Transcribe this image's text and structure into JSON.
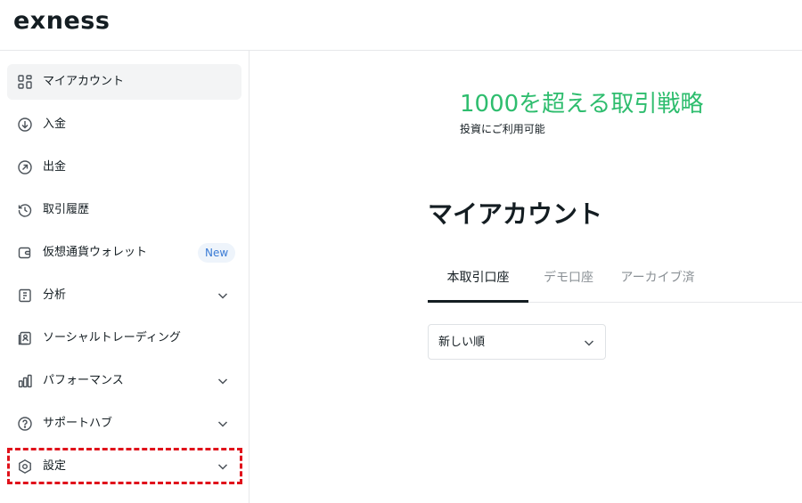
{
  "header": {
    "logo_text": "exness"
  },
  "sidebar": {
    "items": [
      {
        "label": "マイアカウント",
        "icon": "dashboard-icon",
        "active": true
      },
      {
        "label": "入金",
        "icon": "arrow-down-circle-icon"
      },
      {
        "label": "出金",
        "icon": "arrow-up-right-circle-icon"
      },
      {
        "label": "取引履歴",
        "icon": "history-icon"
      },
      {
        "label": "仮想通貨ウォレット",
        "icon": "wallet-icon",
        "badge": "New"
      },
      {
        "label": "分析",
        "icon": "analytics-icon",
        "expandable": true
      },
      {
        "label": "ソーシャルトレーディング",
        "icon": "social-trading-icon"
      },
      {
        "label": "パフォーマンス",
        "icon": "bar-chart-icon",
        "expandable": true
      },
      {
        "label": "サポートハブ",
        "icon": "help-circle-icon",
        "expandable": true
      },
      {
        "label": "設定",
        "icon": "settings-hexagon-icon",
        "expandable": true,
        "highlighted": true
      }
    ]
  },
  "promo": {
    "title": "1000を超える取引戦略",
    "subtitle": "投資にご利用可能"
  },
  "main": {
    "title": "マイアカウント",
    "tabs": [
      {
        "label": "本取引口座",
        "active": true
      },
      {
        "label": "デモ口座"
      },
      {
        "label": "アーカイブ済"
      }
    ],
    "sort": {
      "selected": "新しい順"
    }
  },
  "colors": {
    "accent_green": "#2ebd6e",
    "highlight_red": "#e0121b",
    "badge_blue": "#3a7bd5"
  }
}
